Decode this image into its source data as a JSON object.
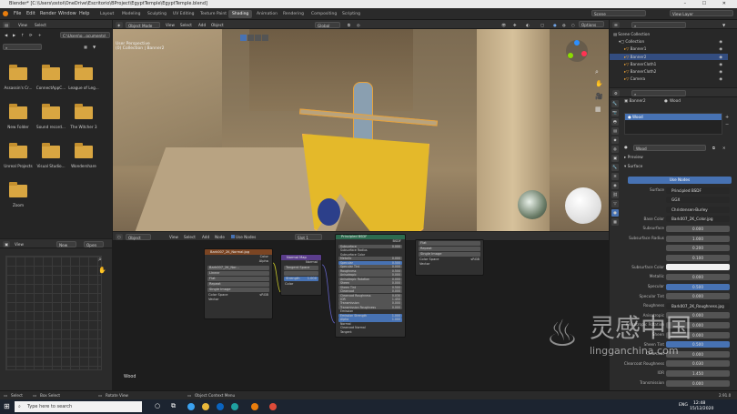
{
  "window": {
    "title": "Blender* [C:\\Users\\ostoi\\OneDrive\\Escritorio\\BProject\\EgyptTemple\\EgyptTemple.blend]",
    "controls": "–  ☐  ✕"
  },
  "menu": [
    "File",
    "Edit",
    "Render",
    "Window",
    "Help"
  ],
  "workspaces": [
    "Layout",
    "Modeling",
    "Sculpting",
    "UV Editing",
    "Texture Paint",
    "Shading",
    "Animation",
    "Rendering",
    "Compositing",
    "Scripting"
  ],
  "active_workspace": "Shading",
  "scene": {
    "label": "Scene",
    "view_layer": "View Layer"
  },
  "file_browser": {
    "header": [
      "View",
      "Select"
    ],
    "path": "C:\\Users\\o...ocuments\\",
    "folders": [
      "Assassin's Cr...",
      "ConnectAppC...",
      "League of Leg...",
      "New Folder",
      "Sound record...",
      "The Witcher 3",
      "Unreal Projects",
      "Visual Studio...",
      "Wondershare",
      "Zoom"
    ]
  },
  "image_editor": {
    "view": "View",
    "new": "New",
    "open": "Open"
  },
  "viewport": {
    "mode": "Object Mode",
    "menus": [
      "View",
      "Select",
      "Add",
      "Object"
    ],
    "orientation": "Global",
    "options": "Options",
    "overlay_line1": "User Perspective",
    "overlay_line2": "(0) Collection | Banner2"
  },
  "node_editor": {
    "editor": "Object",
    "menus": [
      "View",
      "Select",
      "Add",
      "Node"
    ],
    "use_nodes": "Use Nodes",
    "slot": "Slot 1",
    "material": "Wood",
    "footer": "Wood",
    "image_node": {
      "title": "Bark007_2K_Normal.jpg",
      "outputs": [
        "Color",
        "Alpha"
      ],
      "image": "Bark007_2K_Nor...",
      "settings": [
        "Linear",
        "Flat",
        "Repeat",
        "Single Image"
      ],
      "color_space_label": "Color Space",
      "color_space": "sRGB",
      "vector": "Vector"
    },
    "normal_node": {
      "title": "Normal Map",
      "output": "Normal",
      "space": "Tangent Space",
      "strength_label": "Strength",
      "strength": "1.000",
      "color": "Color"
    },
    "bsdf_node": {
      "title": "Principled BSDF",
      "output": "BSDF",
      "rows": [
        {
          "label": "Subsurface",
          "value": "0.000"
        },
        {
          "label": "Subsurface Radius",
          "value": ""
        },
        {
          "label": "Subsurface Color",
          "value": ""
        },
        {
          "label": "Metallic",
          "value": "0.000"
        },
        {
          "label": "Specular",
          "value": "0.500"
        },
        {
          "label": "Specular Tint",
          "value": "0.000"
        },
        {
          "label": "Roughness",
          "value": "0.500"
        },
        {
          "label": "Anisotropic",
          "value": "0.000"
        },
        {
          "label": "Anisotropic Rotation",
          "value": "0.000"
        },
        {
          "label": "Sheen",
          "value": "0.000"
        },
        {
          "label": "Sheen Tint",
          "value": "0.500"
        },
        {
          "label": "Clearcoat",
          "value": "0.000"
        },
        {
          "label": "Clearcoat Roughness",
          "value": "0.030"
        },
        {
          "label": "IOR",
          "value": "1.450"
        },
        {
          "label": "Transmission",
          "value": "0.000"
        },
        {
          "label": "Transmission Roughness",
          "value": "0.000"
        },
        {
          "label": "Emission",
          "value": ""
        },
        {
          "label": "Emission Strength",
          "value": "1.000"
        },
        {
          "label": "Alpha",
          "value": "1.000"
        },
        {
          "label": "Normal",
          "value": ""
        },
        {
          "label": "Clearcoat Normal",
          "value": ""
        },
        {
          "label": "Tangent",
          "value": ""
        }
      ]
    },
    "image_node2": {
      "rows": [
        "Flat",
        "Repeat",
        "Single Image"
      ],
      "color_space_label": "Color Space",
      "color_space": "sRGB",
      "vector": "Vector"
    }
  },
  "outliner": {
    "rows": [
      {
        "name": "Scene Collection",
        "indent": 0
      },
      {
        "name": "Collection",
        "indent": 1
      },
      {
        "name": "Banner1",
        "indent": 2
      },
      {
        "name": "Banner2",
        "indent": 2,
        "selected": true
      },
      {
        "name": "BannerCloth1",
        "indent": 2
      },
      {
        "name": "BannerCloth2",
        "indent": 2
      },
      {
        "name": "Camera",
        "indent": 2
      }
    ]
  },
  "properties": {
    "object": "Banner2",
    "material_name": "Wood",
    "slot_material": "Wood",
    "breadcrumb": "Wood",
    "preview": "Preview",
    "surface": "Surface",
    "use_nodes": "Use Nodes",
    "rows": [
      {
        "label": "Surface",
        "value": "Principled BSDF",
        "style": "dark"
      },
      {
        "label": "",
        "value": "GGX",
        "style": "dark"
      },
      {
        "label": "",
        "value": "Christensen-Burley",
        "style": "dark"
      },
      {
        "label": "Base Color",
        "value": "Bark007_2K_Color.jpg",
        "style": "dark"
      },
      {
        "label": "Subsurface",
        "value": "0.000",
        "style": "normal"
      },
      {
        "label": "Subsurface Radius",
        "value": "1.000",
        "style": "normal"
      },
      {
        "label": "",
        "value": "0.200",
        "style": "normal"
      },
      {
        "label": "",
        "value": "0.100",
        "style": "normal"
      },
      {
        "label": "Subsurface Color",
        "value": "",
        "style": "white"
      },
      {
        "label": "Metallic",
        "value": "0.000",
        "style": "normal"
      },
      {
        "label": "Specular",
        "value": "0.500",
        "style": "blue"
      },
      {
        "label": "Specular Tint",
        "value": "0.000",
        "style": "normal"
      },
      {
        "label": "Roughness",
        "value": "Bark007_2K_Roughness.jpg",
        "style": "dark"
      },
      {
        "label": "Anisotropic",
        "value": "0.000",
        "style": "normal"
      },
      {
        "label": "Anisotropic Rotation",
        "value": "0.000",
        "style": "normal"
      },
      {
        "label": "Sheen",
        "value": "0.000",
        "style": "normal"
      },
      {
        "label": "Sheen Tint",
        "value": "0.500",
        "style": "blue"
      },
      {
        "label": "Clearcoat",
        "value": "0.000",
        "style": "normal"
      },
      {
        "label": "Clearcoat Roughness",
        "value": "0.030",
        "style": "normal"
      },
      {
        "label": "IOR",
        "value": "1.450",
        "style": "normal"
      },
      {
        "label": "Transmission",
        "value": "0.000",
        "style": "normal"
      }
    ]
  },
  "status_bar": {
    "select": "Select",
    "box_select": "Box Select",
    "rotate": "Rotate View",
    "context": "Object Context Menu",
    "version": "2.91.0"
  },
  "taskbar": {
    "search": "Type here to search",
    "lang": "ENG",
    "time": "12:48",
    "date": "15/12/2020"
  },
  "watermark": {
    "cn": "灵感中国",
    "url": "lingganchina.com"
  },
  "colors": {
    "accent": "#4772b3",
    "folder": "#d9a641",
    "selected_row": "#334d80"
  }
}
